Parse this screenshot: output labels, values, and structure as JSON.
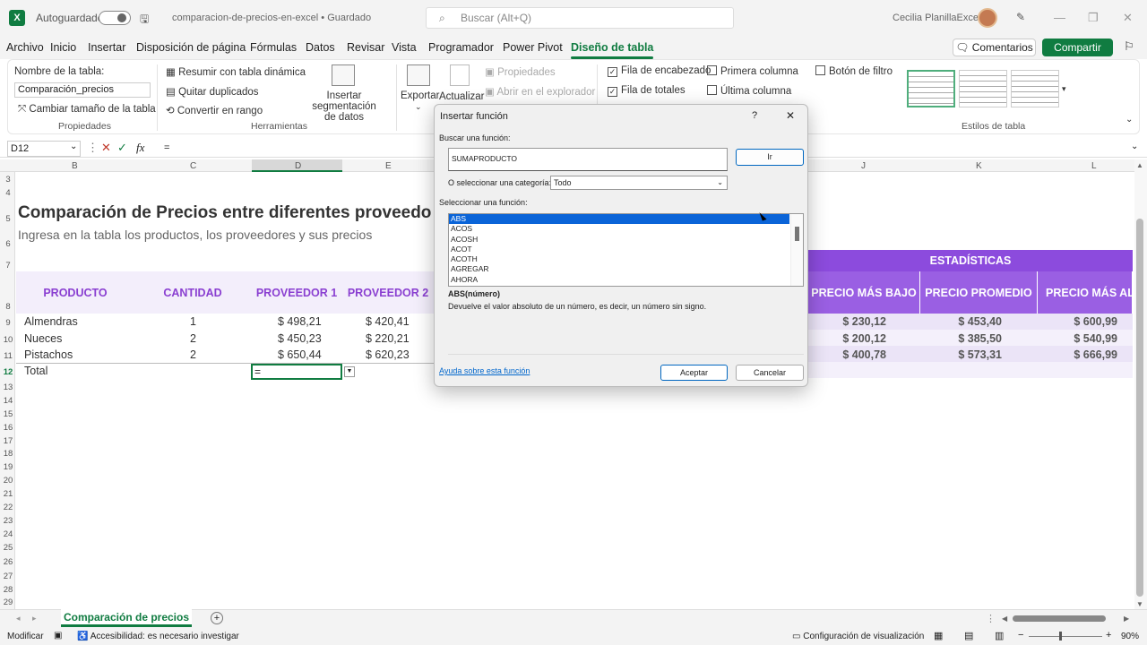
{
  "titlebar": {
    "autosave_label": "Autoguardado",
    "doc_title": "comparacion-de-precios-en-excel • Guardado",
    "search_placeholder": "Buscar (Alt+Q)",
    "user_name": "Cecilia PlanillaExcel"
  },
  "menu": [
    "Archivo",
    "Inicio",
    "Insertar",
    "Disposición de página",
    "Fórmulas",
    "Datos",
    "Revisar",
    "Vista",
    "Programador",
    "Power Pivot",
    "Diseño de tabla"
  ],
  "menu_actions": {
    "comments": "Comentarios",
    "share": "Compartir"
  },
  "ribbon": {
    "table_name_label": "Nombre de la tabla:",
    "table_name_value": "Comparación_precios",
    "resize_table": "Cambiar tamaño de la tabla",
    "group_props": "Propiedades",
    "pivot": "Resumir con tabla dinámica",
    "remove_dupes": "Quitar duplicados",
    "to_range": "Convertir en rango",
    "slicer_line1": "Insertar segmentación",
    "slicer_line2": "de datos",
    "group_tools": "Herramientas",
    "export": "Exportar",
    "refresh": "Actualizar",
    "properties": "Propiedades",
    "open_explorer": "Abrir en el explorador",
    "header_row": "Fila de encabezado",
    "total_row": "Fila de totales",
    "first_col": "Primera columna",
    "last_col": "Última columna",
    "filter_btn": "Botón de filtro",
    "group_styles": "Estilos de tabla"
  },
  "formula": {
    "namebox": "D12",
    "value": "="
  },
  "columns": [
    "B",
    "C",
    "D",
    "E",
    "J",
    "K",
    "L"
  ],
  "rows": [
    "3",
    "4",
    "5",
    "6",
    "7",
    "8",
    "9",
    "10",
    "11",
    "12",
    "13",
    "14",
    "15",
    "16",
    "17",
    "18",
    "19",
    "20",
    "21",
    "22",
    "23",
    "24",
    "25",
    "26",
    "27",
    "28",
    "29"
  ],
  "sheet": {
    "title": "Comparación de Precios entre diferentes proveedo",
    "subtitle": "Ingresa en la tabla los productos, los proveedores y sus precios",
    "headers": {
      "producto": "PRODUCTO",
      "cantidad": "CANTIDAD",
      "prov1": "PROVEEDOR 1",
      "prov2": "PROVEEDOR 2"
    },
    "rows": [
      {
        "producto": "Almendras",
        "cantidad": "1",
        "prov1": "$ 498,21",
        "prov2": "$ 420,41"
      },
      {
        "producto": "Nueces",
        "cantidad": "2",
        "prov1": "$ 450,23",
        "prov2": "$ 220,21"
      },
      {
        "producto": "Pistachos",
        "cantidad": "2",
        "prov1": "$ 650,44",
        "prov2": "$ 620,23"
      }
    ],
    "total_label": "Total",
    "active_value": "=",
    "stats_title": "ESTADÍSTICAS",
    "stats_headers": [
      "PRECIO MÁS BAJO",
      "PRECIO PROMEDIO",
      "PRECIO MÁS ALT"
    ],
    "stats_rows": [
      [
        "$ 230,12",
        "$ 453,40",
        "$ 600,99"
      ],
      [
        "$ 200,12",
        "$ 385,50",
        "$ 540,99"
      ],
      [
        "$ 400,78",
        "$ 573,31",
        "$ 666,99"
      ]
    ]
  },
  "sheet_tab": "Comparación de precios",
  "status": {
    "mode": "Modificar",
    "accessibility": "Accesibilidad: es necesario investigar",
    "display_settings": "Configuración de visualización",
    "zoom": "90%"
  },
  "dialog": {
    "title": "Insertar función",
    "search_label": "Buscar una función:",
    "search_value": "SUMAPRODUCTO",
    "go_button": "Ir",
    "category_label": "O seleccionar una categoría:",
    "category_value": "Todo",
    "select_label": "Seleccionar una función:",
    "functions": [
      "ABS",
      "ACOS",
      "ACOSH",
      "ACOT",
      "ACOTH",
      "AGREGAR",
      "AHORA"
    ],
    "signature": "ABS(número)",
    "description": "Devuelve el valor absoluto de un número, es decir, un número sin signo.",
    "help_link": "Ayuda sobre esta función",
    "ok": "Aceptar",
    "cancel": "Cancelar"
  },
  "colors": {
    "excel_green": "#107c41",
    "table_purple": "#8a3fd1",
    "stats_purple": "#9a5fe3",
    "selection_blue": "#0a64d8"
  }
}
